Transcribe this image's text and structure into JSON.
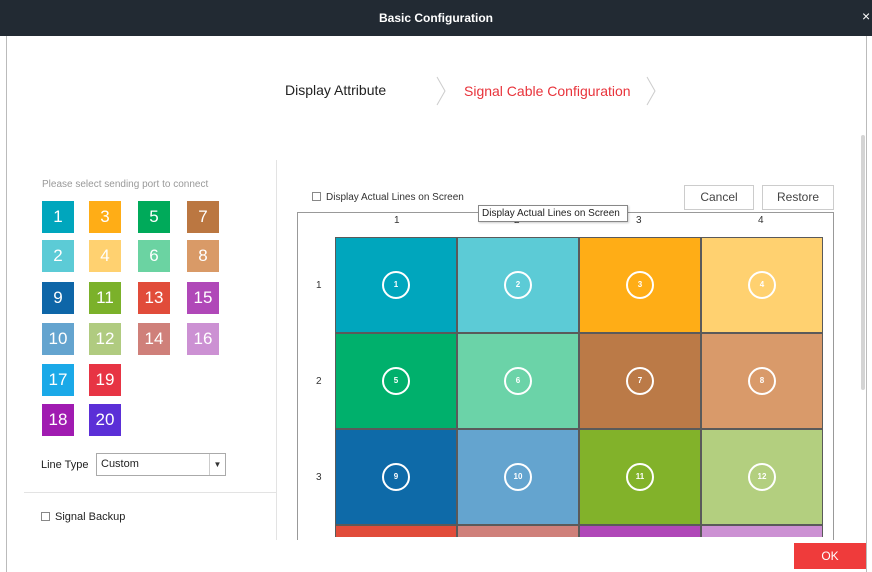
{
  "window": {
    "title": "Basic Configuration",
    "close_glyph": "×"
  },
  "steps": {
    "step1": "Display Attribute",
    "step2": "Signal Cable Configuration"
  },
  "left": {
    "hint": "Please select sending port to connect",
    "ports": [
      {
        "label": "1",
        "color": "#00a6bd"
      },
      {
        "label": "3",
        "color": "#ffad16"
      },
      {
        "label": "5",
        "color": "#00aa5a"
      },
      {
        "label": "7",
        "color": "#bb7741"
      },
      {
        "label": "2",
        "color": "#5ccbd6"
      },
      {
        "label": "4",
        "color": "#ffd170"
      },
      {
        "label": "6",
        "color": "#6bd3a2"
      },
      {
        "label": "8",
        "color": "#d99a67"
      },
      {
        "label": "9",
        "color": "#0e66a8"
      },
      {
        "label": "11",
        "color": "#7bb12a"
      },
      {
        "label": "13",
        "color": "#e14c3a"
      },
      {
        "label": "15",
        "color": "#b048b8"
      },
      {
        "label": "10",
        "color": "#64a4cf"
      },
      {
        "label": "12",
        "color": "#b0cb80"
      },
      {
        "label": "14",
        "color": "#cf807a"
      },
      {
        "label": "16",
        "color": "#cc91d3"
      },
      {
        "label": "17",
        "color": "#1aa9e8"
      },
      {
        "label": "19",
        "color": "#e73444"
      },
      {
        "label": "18",
        "color": "#a01bb1"
      },
      {
        "label": "20",
        "color": "#5b2fd7"
      }
    ],
    "line_type_label": "Line Type",
    "line_type_value": "Custom",
    "signal_backup": "Signal Backup"
  },
  "right": {
    "display_lines_label": "Display Actual Lines on Screen",
    "tooltip": "Display Actual Lines on Screen",
    "cancel": "Cancel",
    "restore": "Restore",
    "col_labels": [
      "1",
      "2",
      "3",
      "4"
    ],
    "row_labels": [
      "1",
      "2",
      "3"
    ],
    "cells": [
      {
        "num": "1",
        "color": "#00a6bd"
      },
      {
        "num": "2",
        "color": "#5ccbd6"
      },
      {
        "num": "3",
        "color": "#ffad16"
      },
      {
        "num": "4",
        "color": "#ffd170"
      },
      {
        "num": "5",
        "color": "#00b06c"
      },
      {
        "num": "6",
        "color": "#6bd3a8"
      },
      {
        "num": "7",
        "color": "#bb7a47"
      },
      {
        "num": "8",
        "color": "#d99a6a"
      },
      {
        "num": "9",
        "color": "#0e6aa8"
      },
      {
        "num": "10",
        "color": "#64a4cf"
      },
      {
        "num": "11",
        "color": "#82b22a"
      },
      {
        "num": "12",
        "color": "#b3cf7f"
      }
    ],
    "partial_row_colors": [
      "#e14c3a",
      "#cf807a",
      "#b048b8",
      "#cc91d3"
    ]
  },
  "footer": {
    "ok": "OK"
  }
}
